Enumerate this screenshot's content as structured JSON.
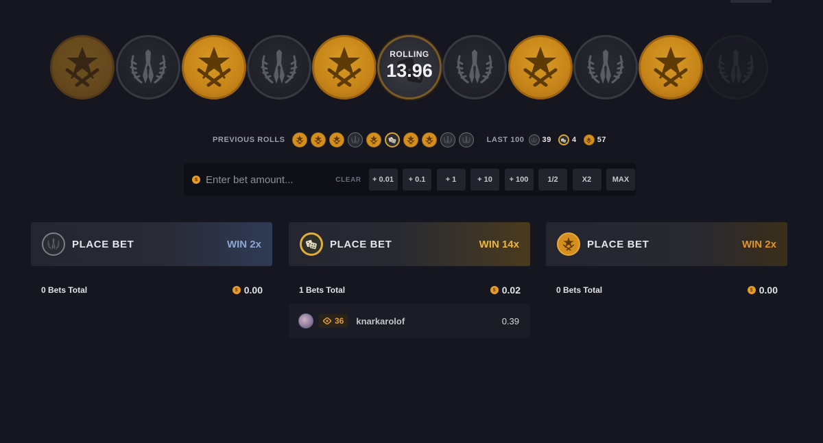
{
  "roller": {
    "coins": [
      "t",
      "ct",
      "t",
      "ct",
      "t",
      "rolling",
      "ct",
      "t",
      "ct",
      "t",
      "ct"
    ],
    "status_label": "ROLLING",
    "timer": "13.96"
  },
  "previous_rolls": {
    "label": "PREVIOUS ROLLS",
    "items": [
      "t",
      "t",
      "t",
      "ct",
      "t",
      "bonus",
      "t",
      "t",
      "ct",
      "ct"
    ]
  },
  "last100": {
    "label": "LAST 100",
    "ct_count": "39",
    "bonus_count": "4",
    "t_count": "57"
  },
  "bet_bar": {
    "placeholder": "Enter bet amount...",
    "clear_label": "CLEAR",
    "buttons": [
      "+ 0.01",
      "+ 0.1",
      "+ 1",
      "+ 10",
      "+ 100",
      "1/2",
      "X2",
      "MAX"
    ]
  },
  "columns": [
    {
      "type": "ct",
      "place_label": "PLACE BET",
      "win_label": "WIN 2x",
      "bets_total": "0 Bets Total",
      "amount": "0.00",
      "bets": []
    },
    {
      "type": "bonus",
      "place_label": "PLACE BET",
      "win_label": "WIN 14x",
      "bets_total": "1 Bets Total",
      "amount": "0.02",
      "bets": [
        {
          "level": "36",
          "username": "knarkarolof",
          "amount": "0.39"
        }
      ]
    },
    {
      "type": "t",
      "place_label": "PLACE BET",
      "win_label": "WIN 2x",
      "bets_total": "0 Bets Total",
      "amount": "0.00",
      "bets": []
    }
  ],
  "colors": {
    "background": "#15161f",
    "t_gold": "#d48f1e",
    "ct_grey": "#2a2b33",
    "bonus_gold": "#e0b03a",
    "win_ct": "#8ea6d4",
    "win_bonus": "#f0b63a",
    "win_t": "#e2962a"
  }
}
